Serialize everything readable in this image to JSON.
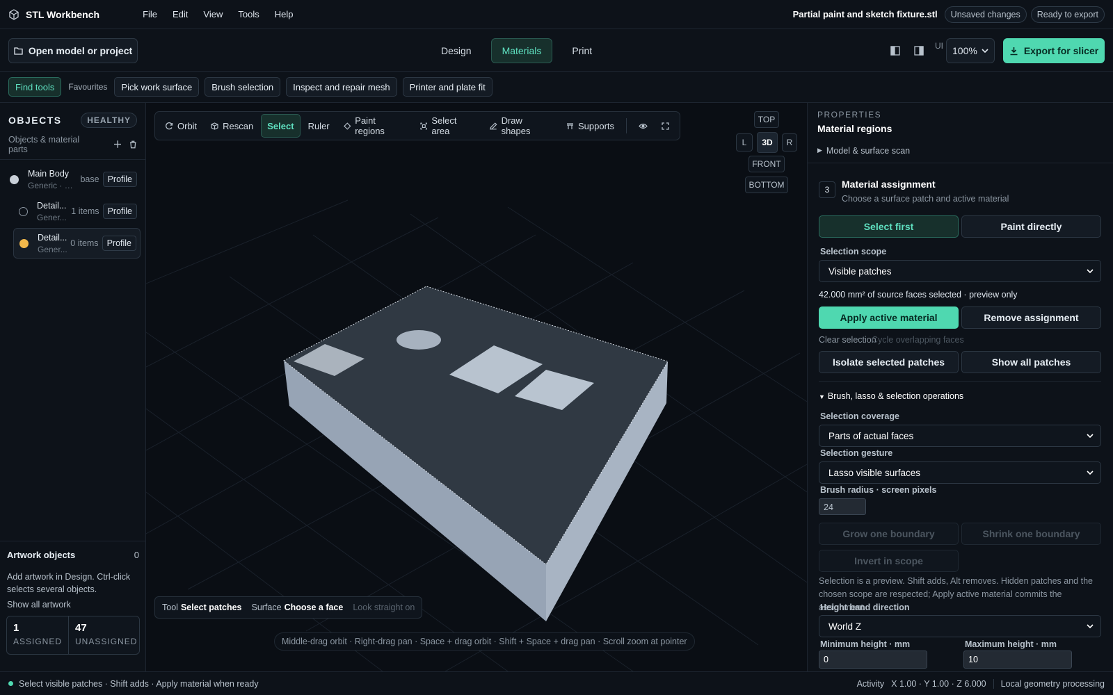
{
  "app": {
    "name": "STL Workbench",
    "menus": [
      "File",
      "Edit",
      "View",
      "Tools",
      "Help"
    ],
    "file_name": "Partial paint and sketch fixture.stl",
    "badges": [
      "Unsaved changes",
      "Ready to export"
    ]
  },
  "toolbar": {
    "open_label": "Open model or project",
    "modes": [
      "Design",
      "Materials",
      "Print"
    ],
    "active_mode": "Materials",
    "ui_label": "UI",
    "zoom": "100%",
    "export_label": "Export for slicer"
  },
  "quickbar": {
    "find_label": "Find tools",
    "favourites_label": "Favourites",
    "items": [
      "Pick work surface",
      "Brush selection",
      "Inspect and repair mesh",
      "Printer and plate fit"
    ]
  },
  "sidebar": {
    "title": "OBJECTS",
    "health": "HEALTHY",
    "subtitle": "Objects & material parts",
    "objects": [
      {
        "name": "Main Body",
        "sub": "Generic · P...",
        "count": "base",
        "profile": "Profile",
        "color": "#c9d0d8"
      },
      {
        "name": "Detail...",
        "sub": "Gener...",
        "count": "1 items",
        "profile": "Profile",
        "color": "transparent"
      },
      {
        "name": "Detail...",
        "sub": "Gener...",
        "count": "0 items",
        "profile": "Profile",
        "color": "#f2b84b"
      }
    ],
    "artwork": {
      "title": "Artwork objects",
      "count": "0",
      "description": "Add artwork in Design. Ctrl-click selects several objects.",
      "link": "Show all artwork"
    },
    "stats": {
      "assigned_value": "1",
      "assigned_label": "ASSIGNED",
      "unassigned_value": "47",
      "unassigned_label": "UNASSIGNED"
    }
  },
  "viewport": {
    "tools": [
      "Orbit",
      "Rescan",
      "Select",
      "Ruler",
      "Paint regions",
      "Select area",
      "Draw shapes",
      "Supports"
    ],
    "active_tool": "Select",
    "view_cube": {
      "top": "TOP",
      "left": "L",
      "center": "3D",
      "right": "R",
      "front": "FRONT",
      "bottom": "BOTTOM"
    },
    "status": {
      "tool_label": "Tool",
      "tool_value": "Select patches",
      "surface_label": "Surface",
      "surface_value": "Choose a face",
      "hint": "Look straight on"
    },
    "controls_hint": "Middle-drag orbit · Right-drag pan · Space + drag orbit · Shift + Space + drag pan · Scroll zoom at pointer"
  },
  "properties": {
    "kicker": "PROPERTIES",
    "title": "Material regions",
    "model_scan": "Model & surface scan",
    "step_number": "3",
    "step_title": "Material assignment",
    "step_sub": "Choose a surface patch and active material",
    "select_first": "Select first",
    "paint_directly": "Paint directly",
    "scope_label": "Selection scope",
    "scope_value": "Visible patches",
    "selection_info": "42.000 mm² of source faces selected · preview only",
    "apply_label": "Apply active material",
    "remove_label": "Remove assignment",
    "clear_selection": "Clear selection",
    "cycle_faces": "Cycle overlapping faces",
    "isolate_label": "Isolate selected patches",
    "show_all_label": "Show all patches",
    "brush_section": "Brush, lasso & selection operations",
    "coverage_label": "Selection coverage",
    "coverage_value": "Parts of actual faces",
    "gesture_label": "Selection gesture",
    "gesture_value": "Lasso visible surfaces",
    "radius_label": "Brush radius · screen pixels",
    "radius_value": "24",
    "grow_label": "Grow one boundary",
    "shrink_label": "Shrink one boundary",
    "invert_label": "Invert in scope",
    "help_text": "Selection is a preview. Shift adds, Alt removes. Hidden patches and the chosen scope are respected; Apply active material commits the assignment.",
    "height_dir_label": "Height band direction",
    "height_dir_value": "World Z",
    "min_height_label": "Minimum height · mm",
    "min_height_value": "0",
    "max_height_label": "Maximum height · mm",
    "max_height_value": "10"
  },
  "statusbar": {
    "message": "Select visible patches · Shift adds · Apply material when ready",
    "activity": "Activity",
    "coords": "X 1.00 · Y 1.00 · Z 6.000",
    "processing": "Local geometry processing"
  },
  "colors": {
    "accent": "#4fd8b0",
    "background": "#0a0e14",
    "panel": "#0d1219",
    "amber": "#f2b84b"
  }
}
